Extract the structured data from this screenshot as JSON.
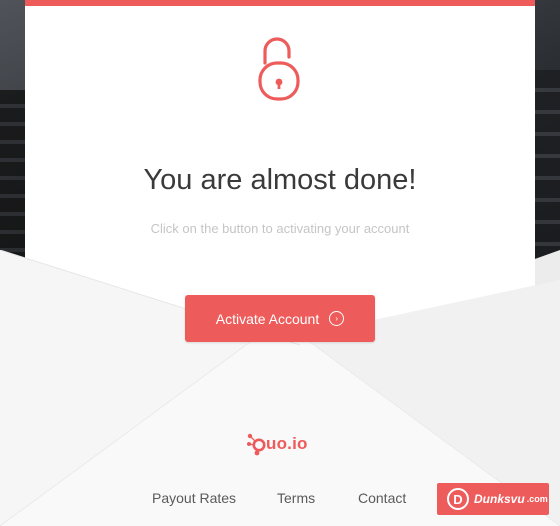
{
  "hero": {
    "title": "You are almost done!",
    "subtitle": "Click on the button to activating your account"
  },
  "cta": {
    "label": "Activate Account",
    "arrow": "›"
  },
  "brand": {
    "name": "uo.io"
  },
  "footer": {
    "links": [
      "Payout Rates",
      "Terms",
      "Contact"
    ]
  },
  "watermark": {
    "initial": "D",
    "text": "Dunksvu",
    "domain": ".com"
  },
  "colors": {
    "accent": "#ee5b5b",
    "title": "#3a3a3a",
    "subtitle": "#c5c5c5"
  },
  "icons": {
    "lock": "unlocked-padlock-icon",
    "button_arrow": "circle-chevron-right-icon"
  }
}
